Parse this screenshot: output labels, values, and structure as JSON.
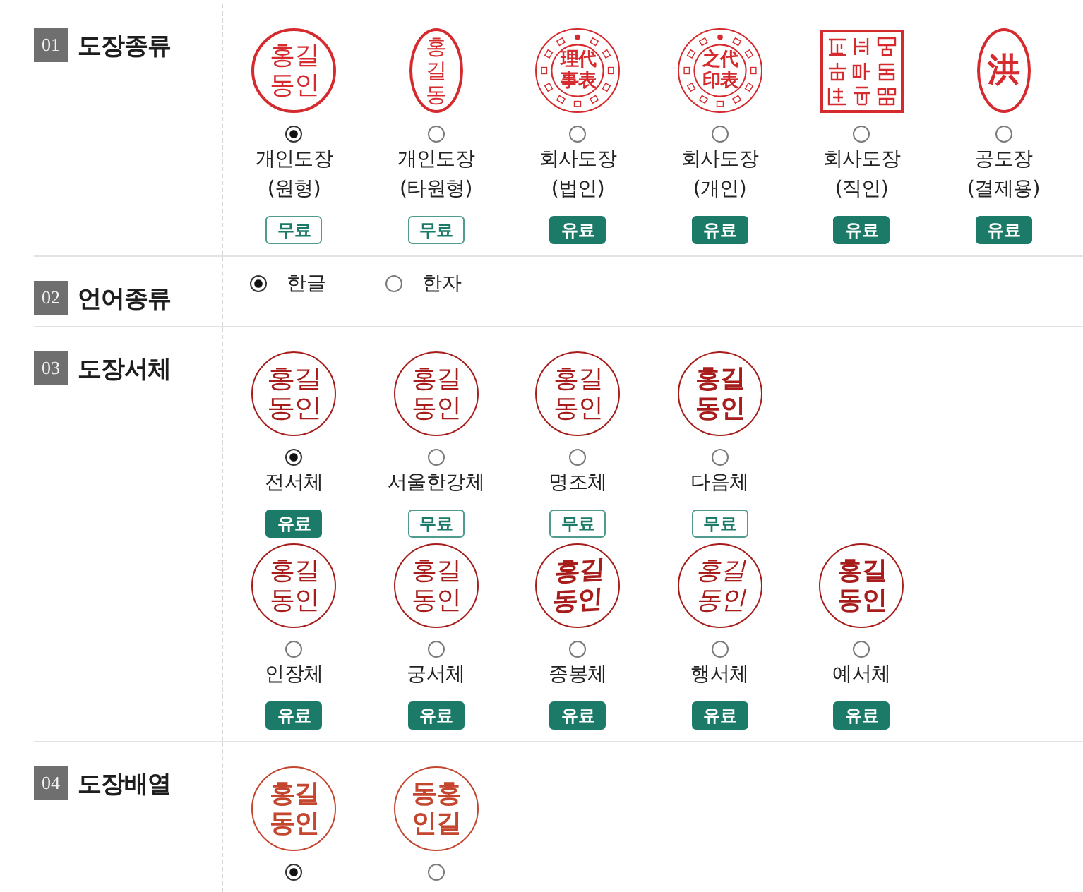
{
  "sections": [
    {
      "number": "01",
      "title": "도장종류",
      "kind": "stamps",
      "item_rows": [
        [
          {
            "seal": {
              "kind": "circle",
              "text": {
                "kind": "sans",
                "lines": [
                  "홍길",
                  "동인"
                ]
              }
            },
            "selected": true,
            "label": "개인도장",
            "sublabel": "(원형)",
            "price": "무료",
            "paid": false
          },
          {
            "seal": {
              "kind": "oval",
              "text": {
                "kind": "sans",
                "lines": [
                  "홍",
                  "길",
                  "동"
                ]
              }
            },
            "selected": false,
            "label": "개인도장",
            "sublabel": "(타원형)",
            "price": "무료",
            "paid": false
          },
          {
            "seal": {
              "kind": "ring",
              "text": {
                "kind": "heavy",
                "lines": [
                  "理代",
                  "事表"
                ]
              }
            },
            "selected": false,
            "label": "회사도장",
            "sublabel": "(법인)",
            "price": "유료",
            "paid": true
          },
          {
            "seal": {
              "kind": "ring",
              "text": {
                "kind": "heavy",
                "lines": [
                  "之代",
                  "印表"
                ]
              }
            },
            "selected": false,
            "label": "회사도장",
            "sublabel": "(개인)",
            "price": "유료",
            "paid": true
          },
          {
            "seal": {
              "kind": "square"
            },
            "selected": false,
            "label": "회사도장",
            "sublabel": "(직인)",
            "price": "유료",
            "paid": true
          },
          {
            "seal": {
              "kind": "oval",
              "text": {
                "kind": "heavy",
                "lines": [
                  "洪"
                ]
              }
            },
            "selected": false,
            "label": "공도장",
            "sublabel": "(결제용)",
            "price": "유료",
            "paid": true
          }
        ]
      ]
    },
    {
      "number": "02",
      "title": "언어종류",
      "kind": "choices",
      "options": [
        {
          "label": "한글",
          "selected": true
        },
        {
          "label": "한자",
          "selected": false
        }
      ]
    },
    {
      "number": "03",
      "title": "도장서체",
      "kind": "stamps",
      "item_rows": [
        [
          {
            "seal": {
              "kind": "circle",
              "text": {
                "kind": "seal",
                "lines": [
                  "홍길",
                  "동인"
                ]
              }
            },
            "selected": true,
            "label": "전서체",
            "price": "유료",
            "paid": true
          },
          {
            "seal": {
              "kind": "circle",
              "text": {
                "kind": "sans",
                "lines": [
                  "홍길",
                  "동인"
                ]
              }
            },
            "selected": false,
            "label": "서울한강체",
            "price": "무료",
            "paid": false
          },
          {
            "seal": {
              "kind": "circle",
              "text": {
                "kind": "serif",
                "lines": [
                  "홍길",
                  "동인"
                ]
              }
            },
            "selected": false,
            "label": "명조체",
            "price": "무료",
            "paid": false
          },
          {
            "seal": {
              "kind": "circle",
              "text": {
                "kind": "heavy",
                "lines": [
                  "홍길",
                  "동인"
                ]
              }
            },
            "selected": false,
            "label": "다음체",
            "price": "무료",
            "paid": false
          }
        ],
        [
          {
            "seal": {
              "kind": "circle",
              "text": {
                "kind": "sans",
                "lines": [
                  "홍길",
                  "동인"
                ]
              }
            },
            "selected": false,
            "label": "인장체",
            "price": "유료",
            "paid": true
          },
          {
            "seal": {
              "kind": "circle",
              "text": {
                "kind": "serif",
                "lines": [
                  "홍길",
                  "동인"
                ]
              }
            },
            "selected": false,
            "label": "궁서체",
            "price": "유료",
            "paid": true
          },
          {
            "seal": {
              "kind": "circle",
              "text": {
                "kind": "brush",
                "lines": [
                  "홍길",
                  "동인"
                ]
              }
            },
            "selected": false,
            "label": "종봉체",
            "price": "유료",
            "paid": true
          },
          {
            "seal": {
              "kind": "circle",
              "text": {
                "kind": "script",
                "lines": [
                  "홍길",
                  "동인"
                ]
              }
            },
            "selected": false,
            "label": "행서체",
            "price": "유료",
            "paid": true
          },
          {
            "seal": {
              "kind": "circle",
              "text": {
                "kind": "heavy",
                "lines": [
                  "홍길",
                  "동인"
                ]
              }
            },
            "selected": false,
            "label": "예서체",
            "price": "유료",
            "paid": true
          }
        ]
      ]
    },
    {
      "number": "04",
      "title": "도장배열",
      "kind": "stamps",
      "item_rows": [
        [
          {
            "seal": {
              "kind": "circle",
              "text": {
                "kind": "heavy",
                "lines": [
                  "홍길",
                  "동인"
                ]
              }
            },
            "selected": true
          },
          {
            "seal": {
              "kind": "circle",
              "text": {
                "kind": "heavy",
                "lines": [
                  "동홍",
                  "인길"
                ]
              }
            },
            "selected": false
          }
        ]
      ]
    }
  ]
}
